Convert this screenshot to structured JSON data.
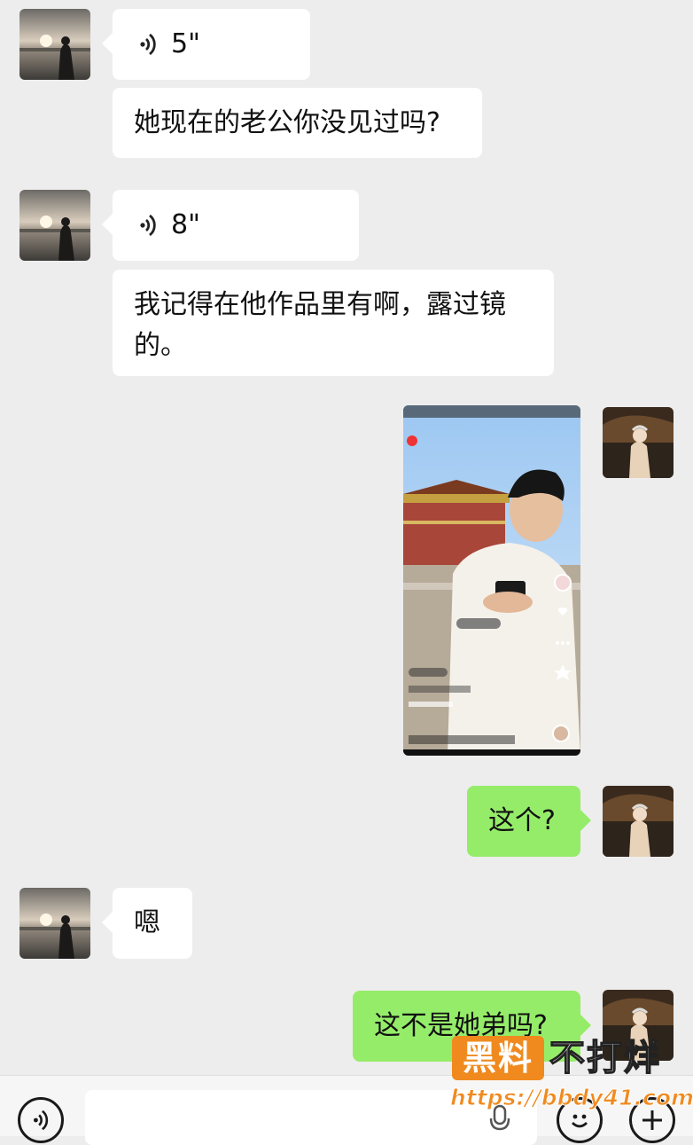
{
  "messages": [
    {
      "side": "in",
      "type": "voice",
      "duration": "5\""
    },
    {
      "side": "in",
      "type": "text",
      "text": "她现在的老公你没见过吗?"
    },
    {
      "side": "in",
      "type": "voice",
      "duration": "8\""
    },
    {
      "side": "in",
      "type": "text",
      "text": "我记得在他作品里有啊，露过镜的。"
    },
    {
      "side": "out",
      "type": "image",
      "description_icon": "video-screenshot"
    },
    {
      "side": "out",
      "type": "text",
      "text": "这个?"
    },
    {
      "side": "in",
      "type": "text",
      "text": "嗯"
    },
    {
      "side": "out",
      "type": "text",
      "text": "这不是她弟吗?"
    }
  ],
  "input_bar": {
    "voice_icon": "voice-toggle-icon",
    "emoji_icon": "emoji-icon",
    "plus_icon": "plus-icon",
    "mic_icon": "mic-icon"
  },
  "watermark": {
    "badge": "黑料",
    "title": "不打烊",
    "url": "https://bbdy41.com"
  },
  "colors": {
    "background": "#ededed",
    "incoming_bubble": "#ffffff",
    "outgoing_bubble": "#95ec69",
    "watermark_orange": "#f08a1f"
  }
}
